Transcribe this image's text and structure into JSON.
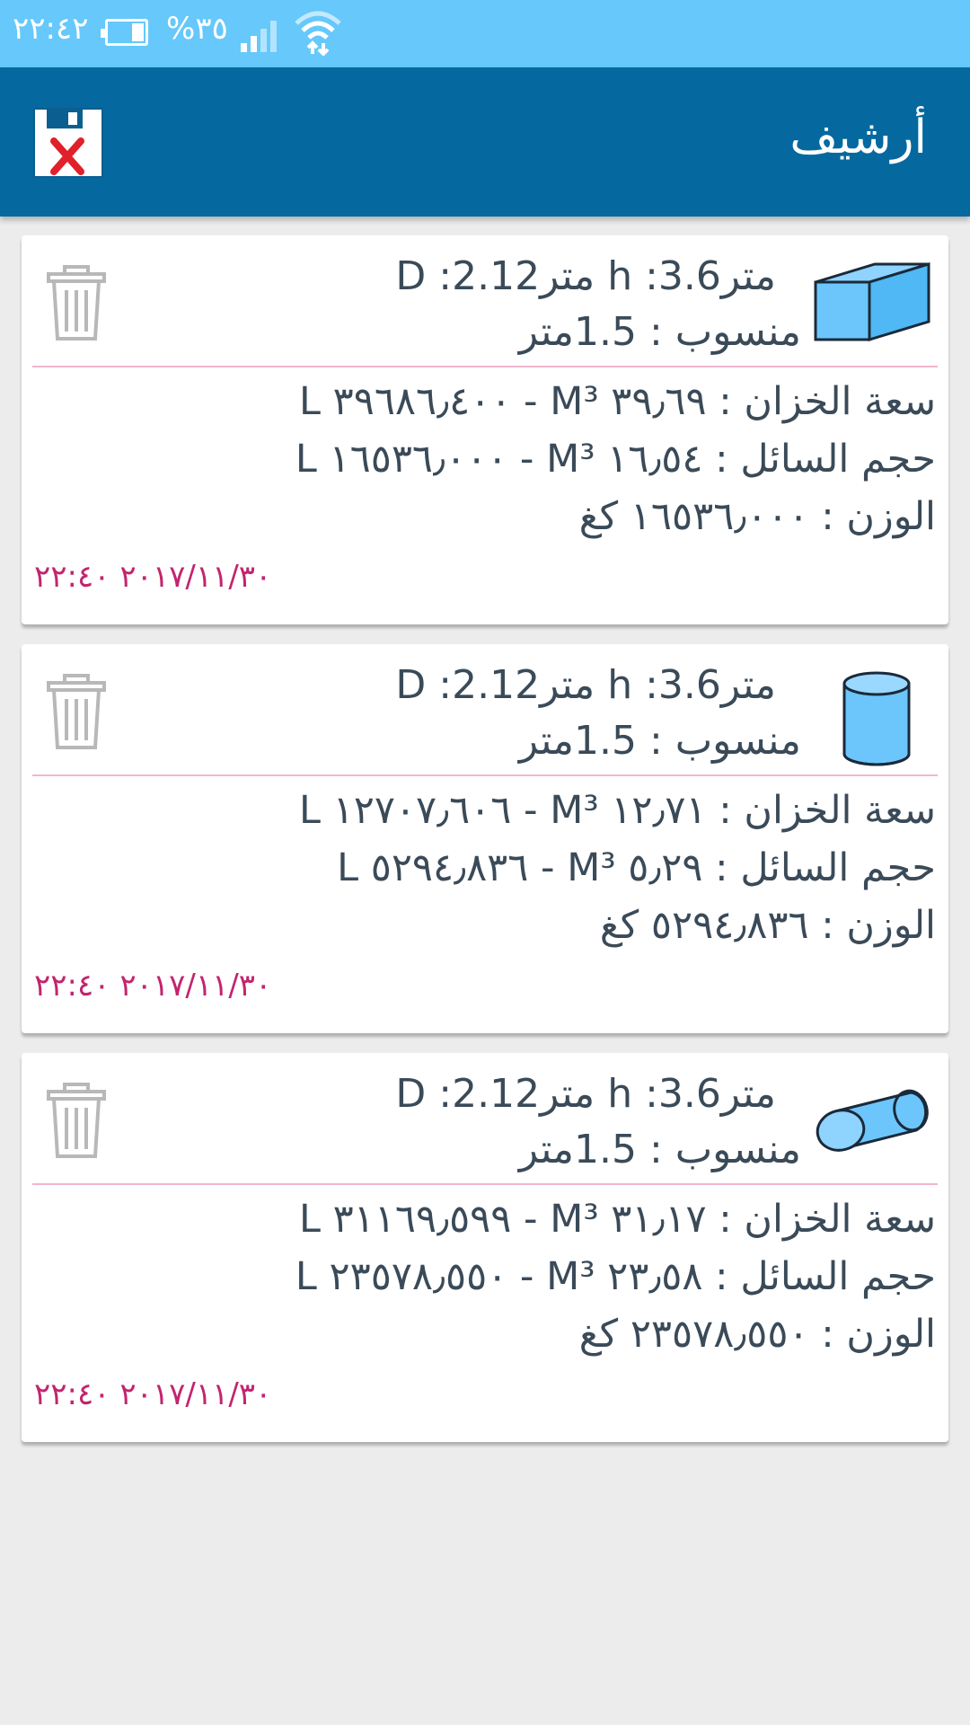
{
  "status_bar": {
    "time": "٢٢:٤٢",
    "battery_text": "%٣٥",
    "battery_level_percent": 35
  },
  "app_bar": {
    "title": "أرشيف",
    "clear_icon": "floppy-disk-delete-icon"
  },
  "records": [
    {
      "shape_icon": "rectangular-tank-icon",
      "dims": "D :2.12متر h :3.6متر",
      "level": "منسوب : 1.5متر",
      "capacity": "سعة الخزان : ٣٩٫٦٩ M³ - ٣٩٦٨٦٫٤٠٠ L",
      "liquid": "حجم السائل : ١٦٫٥٤ M³ - ١٦٥٣٦٫٠٠٠ L",
      "weight": "الوزن : ١٦٥٣٦٫٠٠٠ كغ",
      "date": "٢٠١٧/١١/٣٠ ٢٢:٤٠"
    },
    {
      "shape_icon": "vertical-cylinder-tank-icon",
      "dims": "D :2.12متر h :3.6متر",
      "level": "منسوب : 1.5متر",
      "capacity": "سعة الخزان : ١٢٫٧١ M³ - ١٢٧٠٧٫٦٠٦ L",
      "liquid": "حجم السائل : ٥٫٢٩ M³ - ٥٢٩٤٫٨٣٦ L",
      "weight": "الوزن : ٥٢٩٤٫٨٣٦ كغ",
      "date": "٢٠١٧/١١/٣٠ ٢٢:٤٠"
    },
    {
      "shape_icon": "horizontal-cylinder-tank-icon",
      "dims": "D :2.12متر h :3.6متر",
      "level": "منسوب : 1.5متر",
      "capacity": "سعة الخزان : ٣١٫١٧ M³ - ٣١١٦٩٫٥٩٩ L",
      "liquid": "حجم السائل : ٢٣٫٥٨ M³ - ٢٣٥٧٨٫٥٥٠ L",
      "weight": "الوزن : ٢٣٥٧٨٫٥٥٠ كغ",
      "date": "٢٠١٧/١١/٣٠ ٢٢:٤٠"
    }
  ]
}
